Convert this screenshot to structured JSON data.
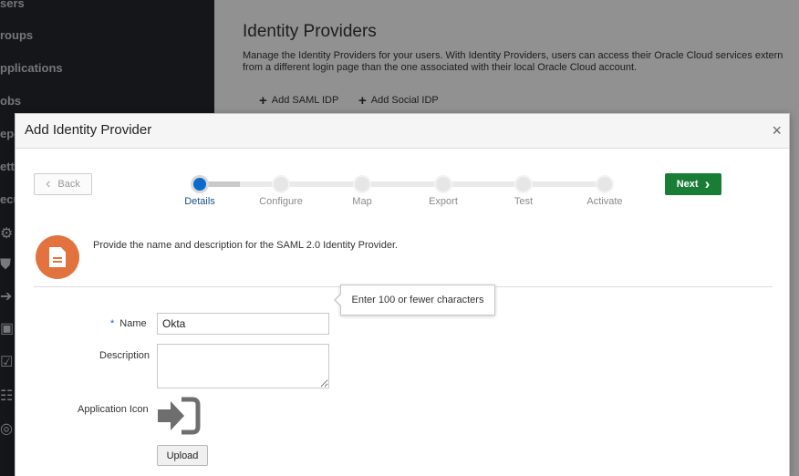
{
  "sidebar": {
    "items": [
      {
        "label": "sers"
      },
      {
        "label": "roups"
      },
      {
        "label": "pplications"
      },
      {
        "label": "obs"
      },
      {
        "label": "epo"
      },
      {
        "label": "etti"
      },
      {
        "label": "ecu"
      }
    ],
    "icons": [
      "gears-icon",
      "shield-icon",
      "sign-in-icon",
      "linkedin-icon",
      "checklist-icon",
      "hierarchy-icon",
      "settings-icon"
    ]
  },
  "main": {
    "title": "Identity Providers",
    "description_line1": "Manage the Identity Providers for your users. With Identity Providers, users can access their Oracle Cloud services extern",
    "description_line2": "from a different login page than the one associated with their local Oracle Cloud account.",
    "add_saml_label": "Add SAML IDP",
    "add_social_label": "Add Social IDP"
  },
  "dialog": {
    "title": "Add Identity Provider",
    "close_glyph": "×",
    "back_label": "Back",
    "next_label": "Next",
    "steps": [
      {
        "label": "Details",
        "state": "current"
      },
      {
        "label": "Configure",
        "state": "pending"
      },
      {
        "label": "Map",
        "state": "pending"
      },
      {
        "label": "Export",
        "state": "pending"
      },
      {
        "label": "Test",
        "state": "pending"
      },
      {
        "label": "Activate",
        "state": "pending"
      }
    ],
    "info_icon": "document-icon",
    "info_text": "Provide the name and description for the SAML 2.0 Identity Provider.",
    "form": {
      "required_marker": "*",
      "name_label": "Name",
      "name_value": "Okta",
      "description_label": "Description",
      "description_value": "",
      "app_icon_label": "Application Icon",
      "app_icon": "sign-in-icon",
      "upload_label": "Upload"
    },
    "tooltip": "Enter 100 or fewer characters"
  },
  "colors": {
    "primary_button": "#1a7d36",
    "active_step": "#0b6bcb",
    "info_icon_bg": "#e2733e",
    "sidebar_bg": "#23262b",
    "required_marker": "#1a63c4"
  }
}
